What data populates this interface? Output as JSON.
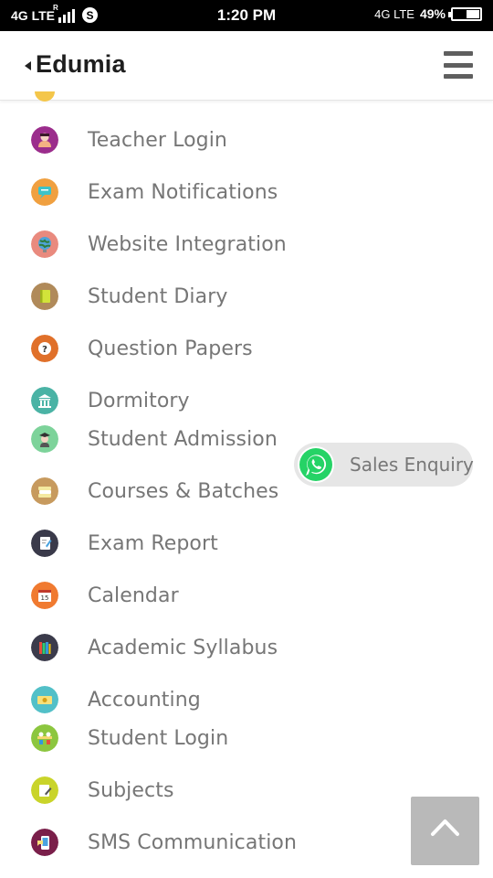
{
  "status_bar": {
    "network_left": "4G LTE",
    "roaming": "R",
    "skype_glyph": "S",
    "time": "1:20 PM",
    "network_right": "4G LTE",
    "battery_percent": "49%",
    "battery_level": 0.49
  },
  "header": {
    "logo": "Edumia",
    "menu_icon": "hamburger-icon"
  },
  "menu": {
    "items": [
      {
        "label": "Teacher Login",
        "icon": "teacher-icon",
        "color": "#9b2d8c"
      },
      {
        "label": "Exam Notifications",
        "icon": "chat-notification-icon",
        "color": "#f0a040"
      },
      {
        "label": "Website Integration",
        "icon": "globe-icon",
        "color": "#e98a7e"
      },
      {
        "label": "Student Diary",
        "icon": "diary-icon",
        "color": "#b08a5a"
      },
      {
        "label": "Question Papers",
        "icon": "question-icon",
        "color": "#e0702a"
      },
      {
        "label": "Dormitory",
        "icon": "building-icon",
        "color": "#4ab3a5"
      },
      {
        "label": "Student Admission",
        "icon": "graduate-icon",
        "color": "#7dd39a"
      },
      {
        "label": "Courses & Batches",
        "icon": "books-stack-icon",
        "color": "#c79a5e"
      },
      {
        "label": "Exam Report",
        "icon": "report-icon",
        "color": "#3a3a4a"
      },
      {
        "label": "Calendar",
        "icon": "calendar-icon",
        "color": "#f07a30"
      },
      {
        "label": "Academic Syllabus",
        "icon": "syllabus-books-icon",
        "color": "#3b3b4b"
      },
      {
        "label": "Accounting",
        "icon": "money-icon",
        "color": "#52c0c8"
      },
      {
        "label": "Student Login",
        "icon": "student-login-icon",
        "color": "#8cc63f"
      },
      {
        "label": "Subjects",
        "icon": "subjects-icon",
        "color": "#c9d42a"
      },
      {
        "label": "SMS Communication",
        "icon": "sms-phone-icon",
        "color": "#7a1f4a"
      }
    ]
  },
  "sales_enquiry": {
    "label": "Sales Enquiry",
    "icon": "whatsapp-icon",
    "color": "#25d366"
  },
  "back_to_top": {
    "icon": "chevron-up-icon"
  }
}
